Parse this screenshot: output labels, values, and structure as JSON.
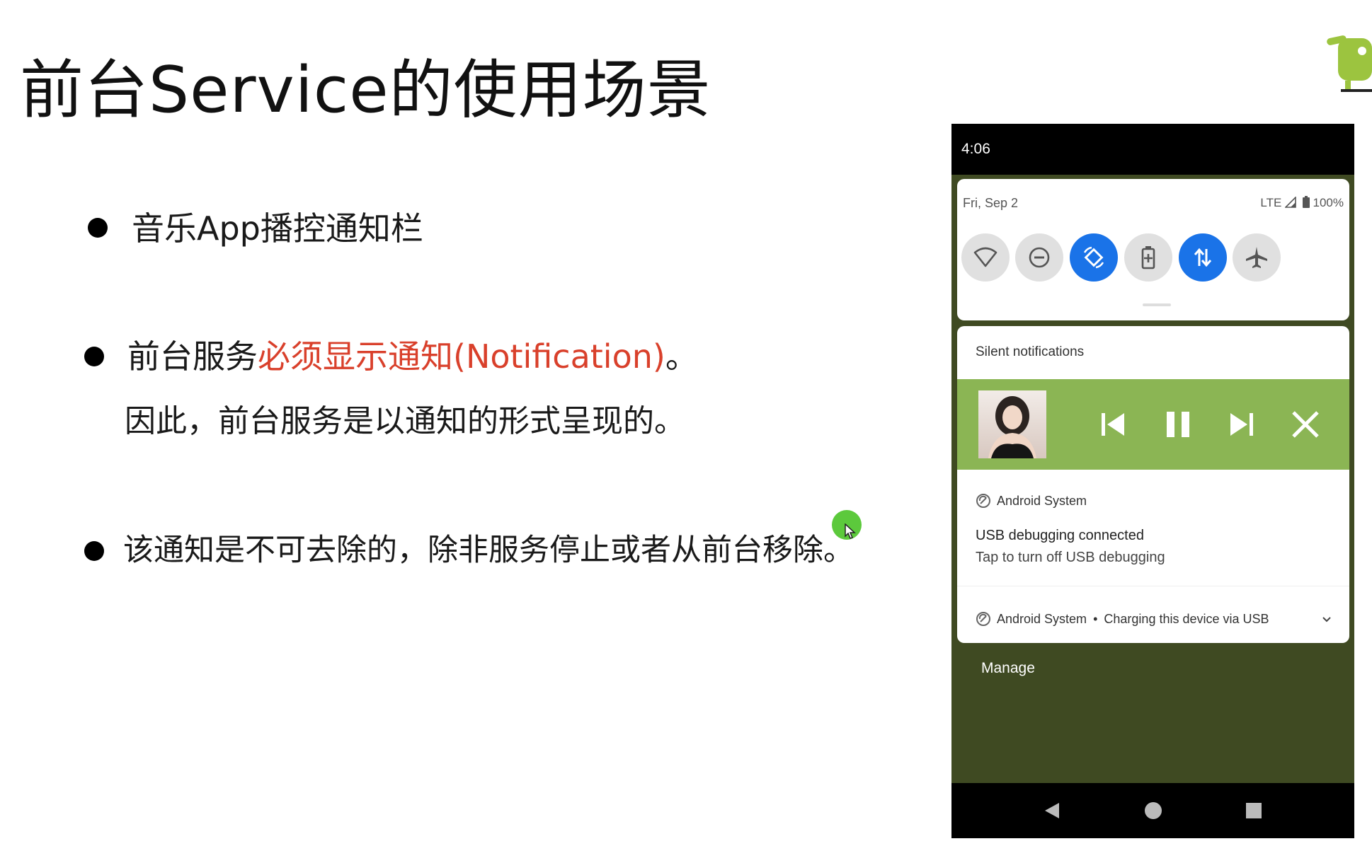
{
  "slide": {
    "title": "前台Service的使用场景",
    "bullets": [
      {
        "text": "音乐App播控通知栏"
      },
      {
        "prefix": "前台服务",
        "highlight": "必须显示通知(Notification)",
        "suffix": "。",
        "subline": "因此，前台服务是以通知的形式呈现的。"
      },
      {
        "text": "该通知是不可去除的，除非服务停止或者从前台移除。"
      }
    ]
  },
  "phone": {
    "status_time": "4:06",
    "quick_settings": {
      "date": "Fri, Sep 2",
      "network": "LTE",
      "battery": "100%",
      "tiles": [
        {
          "icon": "wifi-icon",
          "active": false
        },
        {
          "icon": "do-not-disturb-icon",
          "active": false
        },
        {
          "icon": "auto-rotate-icon",
          "active": true
        },
        {
          "icon": "battery-saver-icon",
          "active": false
        },
        {
          "icon": "mobile-data-icon",
          "active": true
        },
        {
          "icon": "airplane-icon",
          "active": false
        }
      ]
    },
    "notifications": {
      "section_label": "Silent notifications",
      "media_controls": [
        "previous-icon",
        "pause-icon",
        "next-icon",
        "close-icon"
      ],
      "usb": {
        "app": "Android System",
        "title": "USB debugging connected",
        "body": "Tap to turn off USB debugging"
      },
      "charging": {
        "app": "Android System",
        "separator": "•",
        "text": "Charging this device via USB"
      }
    },
    "manage_label": "Manage"
  },
  "colors": {
    "highlight_red": "#d9402b",
    "media_green": "#8bb554",
    "active_tile_blue": "#1a73e8",
    "shade_background": "#3f4a22",
    "cursor_green": "#5cc93c"
  }
}
